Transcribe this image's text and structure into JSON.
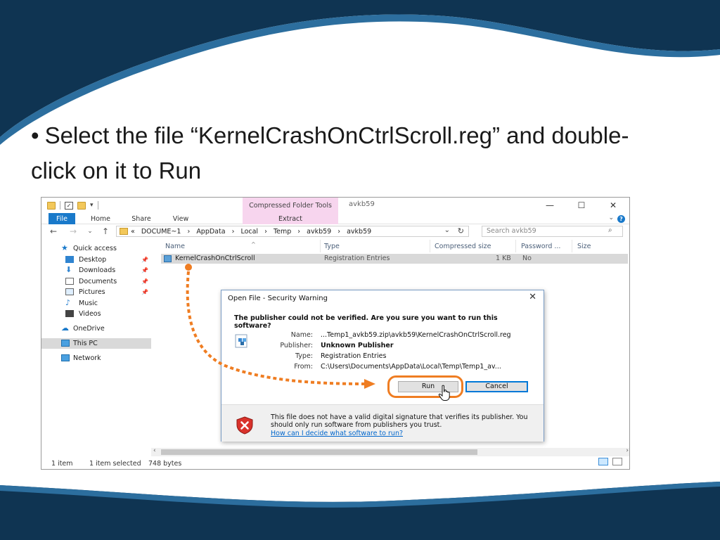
{
  "slide": {
    "bullet": "•",
    "line1": "Select the file “KernelCrashOnCtrlScroll.reg” and double-",
    "line2": "click on it to Run"
  },
  "explorer": {
    "context_tab": "Compressed Folder Tools",
    "window_title": "avkb59",
    "controls": {
      "minimize": "—",
      "maximize": "☐",
      "close": "✕"
    },
    "tabs": {
      "file": "File",
      "home": "Home",
      "share": "Share",
      "view": "View",
      "extract": "Extract"
    },
    "address": {
      "crumbs": [
        "«",
        "DOCUME~1",
        "›",
        "AppData",
        "›",
        "Local",
        "›",
        "Temp",
        "›",
        "avkb59",
        "›",
        "avkb59"
      ]
    },
    "search_placeholder": "Search avkb59",
    "nav": {
      "quick_access": "Quick access",
      "desktop": "Desktop",
      "downloads": "Downloads",
      "documents": "Documents",
      "pictures": "Pictures",
      "music": "Music",
      "videos": "Videos",
      "onedrive": "OneDrive",
      "this_pc": "This PC",
      "network": "Network"
    },
    "columns": {
      "name": "Name",
      "type": "Type",
      "compressed_size": "Compressed size",
      "password": "Password ...",
      "size": "Size"
    },
    "file": {
      "name": "KernelCrashOnCtrlScroll",
      "type": "Registration Entries",
      "compressed_size": "1 KB",
      "password": "No"
    },
    "status": {
      "items": "1 item",
      "selected": "1 item selected",
      "bytes": "748 bytes"
    }
  },
  "dialog": {
    "title": "Open File - Security Warning",
    "close": "✕",
    "question": "The publisher could not be verified.  Are you sure you want to run this software?",
    "labels": {
      "name": "Name:",
      "publisher": "Publisher:",
      "type": "Type:",
      "from": "From:"
    },
    "values": {
      "name": "...Temp1_avkb59.zip\\avkb59\\KernelCrashOnCtrlScroll.reg",
      "publisher": "Unknown Publisher",
      "type": "Registration Entries",
      "from": "C:\\Users\\Documents\\AppData\\Local\\Temp\\Temp1_av..."
    },
    "run_label": "Run",
    "cancel_label": "Cancel",
    "warning": "This file does not have a valid digital signature that verifies its publisher.  You should only run software from publishers you trust.",
    "link": "How can I decide what software to run?"
  },
  "colors": {
    "navy": "#0f3452",
    "accent_blue": "#1979ca",
    "arrow_orange": "#ef7d22",
    "context_pink": "#f7d5ee"
  }
}
